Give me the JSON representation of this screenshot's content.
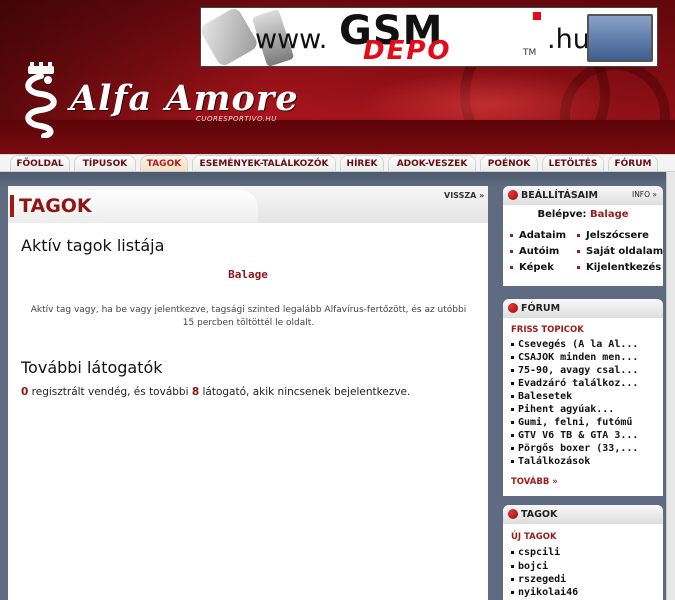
{
  "banner": {
    "url_prefix": "www.",
    "brand_top": "GSM",
    "brand_bottom": "DEPO",
    "tld": ".hu",
    "trademark": "TM"
  },
  "brand": {
    "name": "Alfa Amore",
    "subtitle": "CUORESPORTIVO.HU"
  },
  "nav": {
    "items": [
      "FŐOLDAL",
      "TÍPUSOK",
      "TAGOK",
      "ESEMÉNYEK-TALÁLKOZÓK",
      "HÍREK",
      "ADOK-VESZEK",
      "POÉNOK",
      "LETÖLTÉS",
      "FÓRUM"
    ],
    "active_index": 2
  },
  "main": {
    "title": "TAGOK",
    "back_label": "VISSZA »",
    "active_heading": "Aktív tagok listája",
    "active_user": "Balage",
    "active_note": "Aktív tag vagy, ha be vagy jelentkezve, tagsági szinted legalább Alfavírus-fertőzött, és az utóbbi 15 percben töltöttél le oldalt.",
    "visitors_heading": "További látogatók",
    "guests_count": "0",
    "guests_text": " regisztrált vendég, és további ",
    "visitors_count": "8",
    "visitors_text": " látogató, akik nincsenek bejelentkezve."
  },
  "settings": {
    "title": "BEÁLLÍTÁSAIM",
    "info_label": "INFO »",
    "login_label": "Belépve: ",
    "login_name": "Balage",
    "links": [
      "Adataim",
      "Jelszócsere",
      "Autóim",
      "Saját oldalam",
      "Képek",
      "Kijelentkezés"
    ]
  },
  "forum": {
    "title": "FÓRUM",
    "subtitle": "FRISS TOPICOK",
    "topics": [
      "Csevegés (Á la Al...",
      "CSAJOK minden men...",
      "75-90, avagy csal...",
      "Évadzáró találkoz...",
      "Balesetek",
      "Pihent agyúak...",
      "Gumi, felni, futómű",
      "GTV V6 TB & GTA 3...",
      "Pörgős boxer (33,...",
      "Találkozások"
    ],
    "more_label": "TOVÁBB »"
  },
  "members": {
    "title": "TAGOK",
    "subtitle": "ÚJ TAGOK",
    "items": [
      "cspcili",
      "bojci",
      "rszegedi",
      "nyikolai46"
    ]
  },
  "colors": {
    "accent": "#8f1515",
    "header_red": "#a8151c",
    "page_bg": "#5e6b80"
  }
}
